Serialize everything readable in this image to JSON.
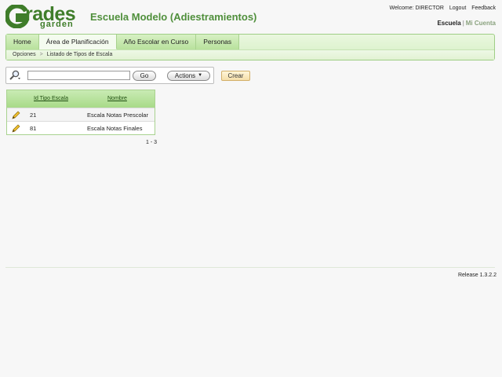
{
  "logo": {
    "main": "rades",
    "sub": "garden"
  },
  "app_title": "Escuela Modelo (Adiestramientos)",
  "header": {
    "welcome": "Welcome: DIRECTOR",
    "logout": "Logout",
    "feedback": "Feedback",
    "context_active": "Escuela",
    "context_sep": "|",
    "context_other": "Mi Cuenta"
  },
  "tabs": [
    {
      "label": "Home"
    },
    {
      "label": "Área de Planificación"
    },
    {
      "label": "Año Escolar en Curso"
    },
    {
      "label": "Personas"
    }
  ],
  "breadcrumb": {
    "item1": "Opciones",
    "sep": ">",
    "item2": "Listado de Tipos de Escala"
  },
  "search": {
    "value": "",
    "go_label": "Go",
    "actions_label": "Actions",
    "caret": "▼"
  },
  "crear_label": "Crear",
  "table": {
    "columns": [
      "Id Tipo Escala",
      "Nombre"
    ],
    "rows": [
      {
        "id": "21",
        "name": "Escala Notas Prescolar"
      },
      {
        "id": "81",
        "name": "Escala Notas Finales"
      }
    ]
  },
  "pagination": "1 - 3",
  "release": "Release 1.3.2.2",
  "colors": {
    "brand_green": "#3f7d2a",
    "tab_green": "#b8e19c",
    "crear_bg": "#f5deaa"
  }
}
